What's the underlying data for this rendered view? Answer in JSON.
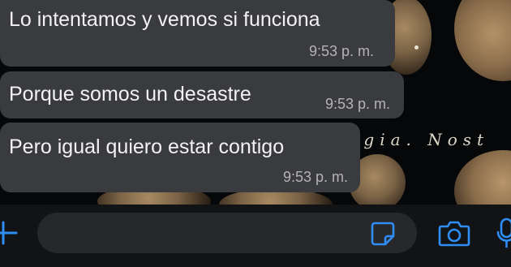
{
  "messages": [
    {
      "text": "Lo intentamos y vemos si funciona",
      "time": "9:53 p. m."
    },
    {
      "text": "Porque somos un desastre",
      "time": "9:53 p. m."
    },
    {
      "text": "Pero igual quiero estar contigo",
      "time": "9:53 p. m."
    }
  ],
  "wallpaper": {
    "text": "lgia. Nost"
  },
  "composer": {
    "placeholder": ""
  },
  "icons": {
    "attach": "plus-icon",
    "sticker": "sticker-icon",
    "camera": "camera-icon",
    "microphone": "mic-icon"
  },
  "colors": {
    "accent": "#2f8ef5",
    "bubble": "#3a3b3f",
    "background": "#06080b"
  }
}
